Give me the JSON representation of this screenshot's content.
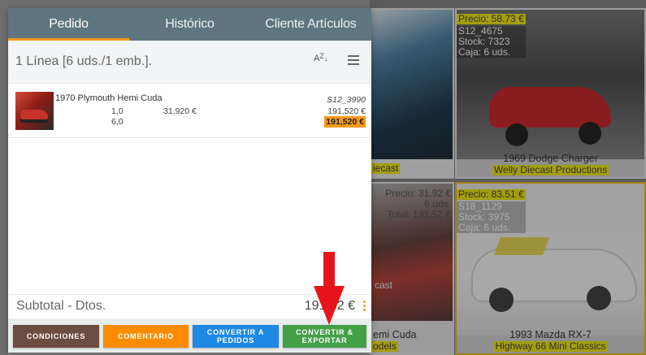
{
  "tabs": [
    {
      "label": "Pedido"
    },
    {
      "label": "Histórico"
    },
    {
      "label": "Cliente Artículos"
    }
  ],
  "summary": {
    "text": "1 Línea [6 uds./1 emb.].",
    "sort_icon": "sort-az-icon",
    "menu_icon": "list-menu-icon"
  },
  "order_line": {
    "name": "1970 Plymouth Hemi Cuda",
    "code": "S12_3990",
    "qty1": "1,0",
    "qty2": "6,0",
    "unit_price": "31,920 €",
    "price": "191,520 €",
    "total": "191,520 €"
  },
  "footer": {
    "subtotal_label": "Subtotal - Dtos.",
    "subtotal_value": "191,52 €",
    "buttons": {
      "condiciones": "CONDICIONES",
      "comentario": "COMENTARIO",
      "convertir_pedidos": "CONVERTIR A PEDIDOS",
      "convertir_exportar": "CONVERTIR & EXPORTAR"
    }
  },
  "background_products": [
    {
      "caption_tail": "iecast"
    },
    {
      "price": "Precio: 58.73 €",
      "code": "S12_4675",
      "stock": "Stock: 7323",
      "box": "Caja: 6 uds.",
      "name": "1969 Dodge Charger",
      "vendor": "Welly Diecast Productions"
    },
    {
      "price": "Precio: 31.92 €",
      "units": "6 uds.",
      "total": "Total: 191.52 €",
      "name_tail": "emi Cuda",
      "vendor_tail": "odels",
      "left_tail": "cast"
    },
    {
      "price": "Precio: 83.51 €",
      "code": "S18_1129",
      "stock": "Stock: 3975",
      "box": "Caja: 6 uds.",
      "name": "1993 Mazda RX-7",
      "vendor": "Highway 66 Mini Classics"
    }
  ],
  "colors": {
    "tab_bar": "#5f757f",
    "accent": "#f39a1a",
    "btn_condiciones": "#6d4c41",
    "btn_comentario": "#fb8c00",
    "btn_convertir_pedidos": "#1e88e5",
    "btn_convertir_exportar": "#43a047",
    "arrow": "#e8141c"
  }
}
